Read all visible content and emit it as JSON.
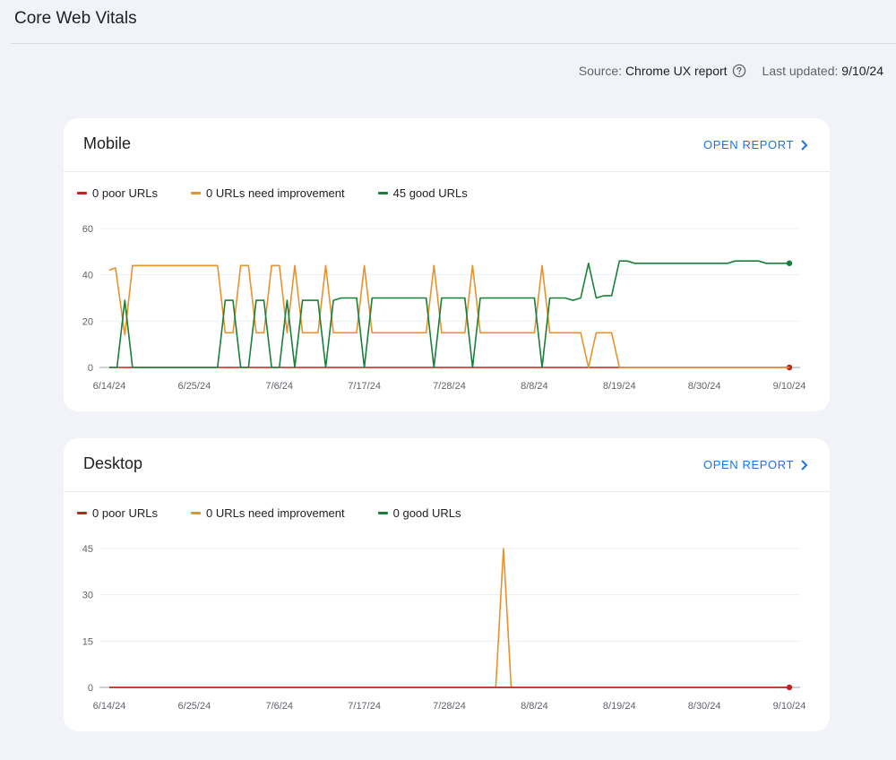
{
  "page": {
    "title": "Core Web Vitals"
  },
  "meta": {
    "source_label": "Source:",
    "source_value": "Chrome UX report",
    "updated_label": "Last updated:",
    "updated_value": "9/10/24"
  },
  "colors": {
    "poor": "#c5221f",
    "needs_improvement": "#e8912d",
    "good": "#188038",
    "link": "#1a73e8"
  },
  "cards": [
    {
      "title": "Mobile",
      "open_report": "OPEN REPORT",
      "legend": [
        {
          "label": "0 poor URLs",
          "color": "#c5221f"
        },
        {
          "label": "0 URLs need improvement",
          "color": "#e8912d"
        },
        {
          "label": "45 good URLs",
          "color": "#188038"
        }
      ]
    },
    {
      "title": "Desktop",
      "open_report": "OPEN REPORT",
      "legend": [
        {
          "label": "0 poor URLs",
          "color": "#c5221f"
        },
        {
          "label": "0 URLs need improvement",
          "color": "#e8912d"
        },
        {
          "label": "0 good URLs",
          "color": "#188038"
        }
      ]
    }
  ],
  "chart_data": [
    {
      "type": "line",
      "x_tick_labels": [
        "6/14/24",
        "6/25/24",
        "7/6/24",
        "7/17/24",
        "7/28/24",
        "8/8/24",
        "8/19/24",
        "8/30/24",
        "9/10/24"
      ],
      "yticks": [
        0,
        20,
        40,
        60
      ],
      "ylim": [
        0,
        60
      ],
      "grid": true,
      "series": [
        {
          "name": "0 poor URLs",
          "color": "#c5221f",
          "points": [
            [
              0,
              0
            ],
            [
              88,
              0
            ]
          ],
          "end_marker": true
        },
        {
          "name": "0 URLs need improvement",
          "color": "#e8912d",
          "points": [
            [
              0,
              42
            ],
            [
              0.8,
              43
            ],
            [
              2,
              14
            ],
            [
              3,
              44
            ],
            [
              14,
              44
            ],
            [
              15,
              15
            ],
            [
              16,
              15
            ],
            [
              17,
              44
            ],
            [
              18,
              44
            ],
            [
              19,
              15
            ],
            [
              20,
              15
            ],
            [
              21,
              44
            ],
            [
              22,
              44
            ],
            [
              23,
              15
            ],
            [
              24,
              44
            ],
            [
              25,
              15
            ],
            [
              27,
              15
            ],
            [
              28,
              44
            ],
            [
              29,
              15
            ],
            [
              32,
              15
            ],
            [
              33,
              44
            ],
            [
              34,
              15
            ],
            [
              41,
              15
            ],
            [
              42,
              44
            ],
            [
              43,
              15
            ],
            [
              46,
              15
            ],
            [
              47,
              44
            ],
            [
              48,
              15
            ],
            [
              55,
              15
            ],
            [
              56,
              44
            ],
            [
              57,
              15
            ],
            [
              61,
              15
            ],
            [
              62,
              0
            ],
            [
              63,
              15
            ],
            [
              65,
              15
            ],
            [
              66,
              0
            ],
            [
              88,
              0
            ]
          ]
        },
        {
          "name": "45 good URLs",
          "color": "#188038",
          "points": [
            [
              0,
              0
            ],
            [
              1,
              0
            ],
            [
              2,
              29
            ],
            [
              3,
              0
            ],
            [
              14,
              0
            ],
            [
              15,
              29
            ],
            [
              16,
              29
            ],
            [
              17,
              0
            ],
            [
              18,
              0
            ],
            [
              19,
              29
            ],
            [
              20,
              29
            ],
            [
              21,
              0
            ],
            [
              22,
              0
            ],
            [
              23,
              29
            ],
            [
              24,
              0
            ],
            [
              25,
              29
            ],
            [
              27,
              29
            ],
            [
              28,
              0
            ],
            [
              29,
              29
            ],
            [
              30,
              30
            ],
            [
              32,
              30
            ],
            [
              33,
              0
            ],
            [
              34,
              30
            ],
            [
              41,
              30
            ],
            [
              42,
              0
            ],
            [
              43,
              30
            ],
            [
              46,
              30
            ],
            [
              47,
              0
            ],
            [
              48,
              30
            ],
            [
              55,
              30
            ],
            [
              56,
              0
            ],
            [
              57,
              30
            ],
            [
              59,
              30
            ],
            [
              60,
              29
            ],
            [
              61,
              30
            ],
            [
              62,
              45
            ],
            [
              63,
              30
            ],
            [
              64,
              31
            ],
            [
              65,
              31
            ],
            [
              66,
              46
            ],
            [
              67,
              46
            ],
            [
              68,
              45
            ],
            [
              80,
              45
            ],
            [
              81,
              46
            ],
            [
              84,
              46
            ],
            [
              85,
              45
            ],
            [
              87,
              45
            ],
            [
              88,
              45
            ]
          ],
          "end_marker": true
        }
      ]
    },
    {
      "type": "line",
      "x_tick_labels": [
        "6/14/24",
        "6/25/24",
        "7/6/24",
        "7/17/24",
        "7/28/24",
        "8/8/24",
        "8/19/24",
        "8/30/24",
        "9/10/24"
      ],
      "yticks": [
        0,
        15,
        30,
        45
      ],
      "ylim": [
        0,
        45
      ],
      "grid": true,
      "series": [
        {
          "name": "0 good URLs",
          "color": "#188038",
          "points": [
            [
              0,
              0
            ],
            [
              88,
              0
            ]
          ]
        },
        {
          "name": "0 URLs need improvement",
          "color": "#e8912d",
          "points": [
            [
              0,
              0
            ],
            [
              50,
              0
            ],
            [
              51,
              45
            ],
            [
              52,
              0
            ],
            [
              88,
              0
            ]
          ]
        },
        {
          "name": "0 poor URLs",
          "color": "#c5221f",
          "points": [
            [
              0,
              0
            ],
            [
              88,
              0
            ]
          ],
          "end_marker": true
        }
      ]
    }
  ]
}
